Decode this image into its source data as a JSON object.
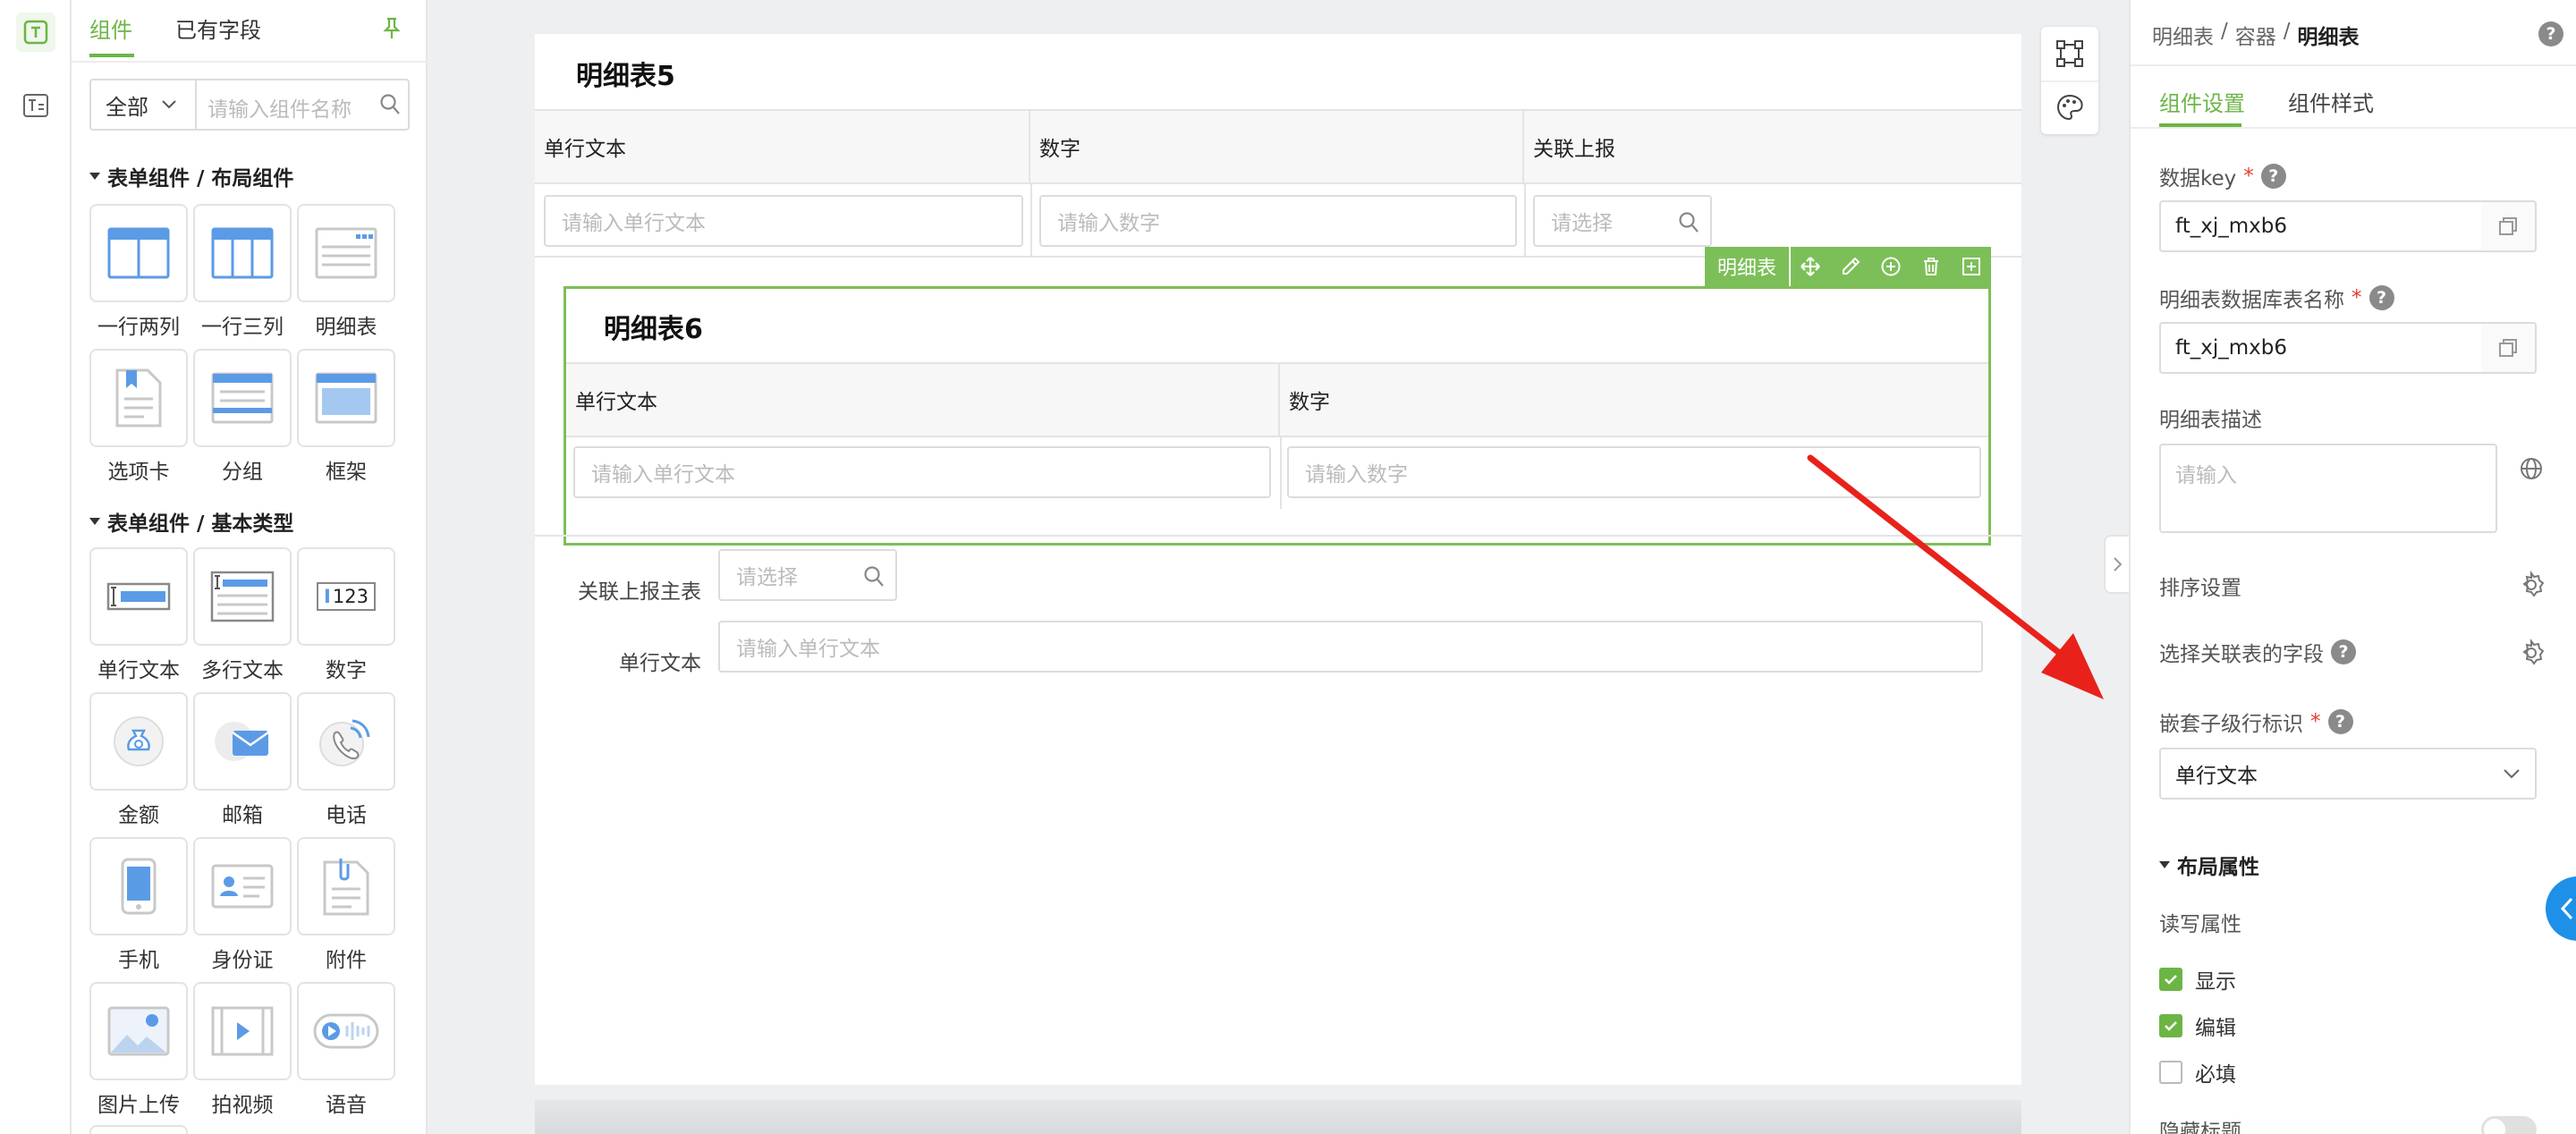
{
  "left_panel": {
    "tabs": [
      "组件",
      "已有字段"
    ],
    "filter_selected": "全部",
    "search_placeholder": "请输入组件名称",
    "sections": [
      {
        "title": "表单组件 / 布局组件",
        "items": [
          "一行两列",
          "一行三列",
          "明细表",
          "选项卡",
          "分组",
          "框架"
        ]
      },
      {
        "title": "表单组件 / 基本类型",
        "items": [
          "单行文本",
          "多行文本",
          "数字",
          "金额",
          "邮箱",
          "电话",
          "手机",
          "身份证",
          "附件",
          "图片上传",
          "拍视频",
          "语音"
        ]
      }
    ],
    "number_icon_text": "123"
  },
  "canvas": {
    "table5": {
      "title": "明细表5",
      "columns": [
        "单行文本",
        "数字",
        "关联上报"
      ],
      "placeholders": [
        "请输入单行文本",
        "请输入数字",
        "请选择"
      ]
    },
    "toolbar_label": "明细表",
    "table6": {
      "title": "明细表6",
      "columns": [
        "单行文本",
        "数字"
      ],
      "placeholders": [
        "请输入单行文本",
        "请输入数字"
      ]
    },
    "fields": [
      {
        "label": "关联上报主表",
        "placeholder": "请选择"
      },
      {
        "label": "单行文本",
        "placeholder": "请输入单行文本"
      }
    ]
  },
  "right_panel": {
    "breadcrumb": [
      "明细表",
      "/",
      "容器",
      "/",
      "明细表"
    ],
    "tabs": [
      "组件设置",
      "组件样式"
    ],
    "data_key_label": "数据key",
    "data_key_value": "ft_xj_mxb6",
    "db_table_label": "明细表数据库表名称",
    "db_table_value": "ft_xj_mxb6",
    "desc_label": "明细表描述",
    "desc_placeholder": "请输入",
    "sort_label": "排序设置",
    "assoc_label": "选择关联表的字段",
    "nested_label": "嵌套子级行标识",
    "nested_value": "单行文本",
    "layout_section": "布局属性",
    "rw_label": "读写属性",
    "checkboxes": [
      {
        "label": "显示",
        "checked": true
      },
      {
        "label": "编辑",
        "checked": true
      },
      {
        "label": "必填",
        "checked": false
      }
    ],
    "hide_title_label": "隐藏标题",
    "required_mark": "*",
    "help_mark": "?"
  },
  "colors": {
    "accent": "#6bb545",
    "arrow": "#e8221b",
    "side_button": "#1e90e8"
  }
}
